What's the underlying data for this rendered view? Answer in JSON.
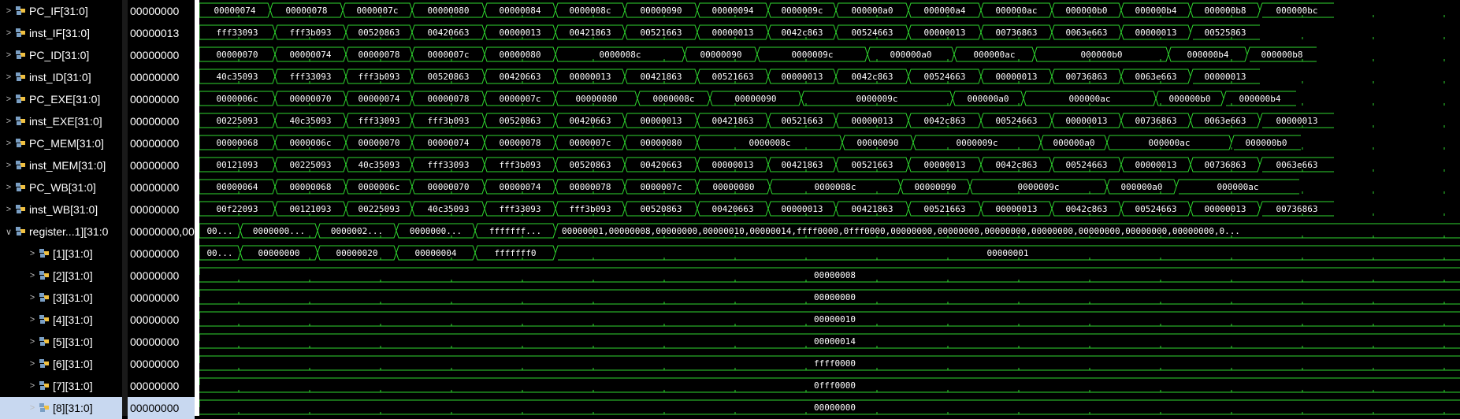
{
  "signals": [
    {
      "name": "PC_IF[31:0]",
      "value": "00000000",
      "expanded": false,
      "indent": 0,
      "segments": [
        "00000074",
        "00000078",
        "0000007c",
        "00000080",
        "00000084",
        "0000008c",
        "00000090",
        "00000094",
        "0000009c",
        "000000a0",
        "000000a4",
        "000000ac",
        "000000b0",
        "000000b4",
        "000000b8",
        "000000bc"
      ]
    },
    {
      "name": "inst_IF[31:0]",
      "value": "00000013",
      "expanded": false,
      "indent": 0,
      "segments": [
        "fff33093",
        "fff3b093",
        "00520863",
        "00420663",
        "00000013",
        "00421863",
        "00521663",
        "00000013",
        "0042c863",
        "00524663",
        "00000013",
        "00736863",
        "0063e663",
        "00000013",
        "00525863"
      ]
    },
    {
      "name": "PC_ID[31:0]",
      "value": "00000000",
      "expanded": false,
      "indent": 0,
      "segments": [
        "00000070",
        "00000074",
        "00000078",
        "0000007c",
        "00000080",
        "0000008c",
        "00000090",
        "0000009c",
        "000000a0",
        "000000ac",
        "000000b0",
        "000000b4",
        "000000b8"
      ]
    },
    {
      "name": "inst_ID[31:0]",
      "value": "00000000",
      "expanded": false,
      "indent": 0,
      "segments": [
        "40c35093",
        "fff33093",
        "fff3b093",
        "00520863",
        "00420663",
        "00000013",
        "00421863",
        "00521663",
        "00000013",
        "0042c863",
        "00524663",
        "00000013",
        "00736863",
        "0063e663",
        "00000013"
      ]
    },
    {
      "name": "PC_EXE[31:0]",
      "value": "00000000",
      "expanded": false,
      "indent": 0,
      "segments": [
        "0000006c",
        "00000070",
        "00000074",
        "00000078",
        "0000007c",
        "00000080",
        "0000008c",
        "00000090",
        "0000009c",
        "000000a0",
        "000000ac",
        "000000b0",
        "000000b4"
      ]
    },
    {
      "name": "inst_EXE[31:0]",
      "value": "00000000",
      "expanded": false,
      "indent": 0,
      "segments": [
        "00225093",
        "40c35093",
        "fff33093",
        "fff3b093",
        "00520863",
        "00420663",
        "00000013",
        "00421863",
        "00521663",
        "00000013",
        "0042c863",
        "00524663",
        "00000013",
        "00736863",
        "0063e663",
        "00000013"
      ]
    },
    {
      "name": "PC_MEM[31:0]",
      "value": "00000000",
      "expanded": false,
      "indent": 0,
      "segments": [
        "00000068",
        "0000006c",
        "00000070",
        "00000074",
        "00000078",
        "0000007c",
        "00000080",
        "0000008c",
        "00000090",
        "0000009c",
        "000000a0",
        "000000ac",
        "000000b0"
      ]
    },
    {
      "name": "inst_MEM[31:0]",
      "value": "00000000",
      "expanded": false,
      "indent": 0,
      "segments": [
        "00121093",
        "00225093",
        "40c35093",
        "fff33093",
        "fff3b093",
        "00520863",
        "00420663",
        "00000013",
        "00421863",
        "00521663",
        "00000013",
        "0042c863",
        "00524663",
        "00000013",
        "00736863",
        "0063e663"
      ]
    },
    {
      "name": "PC_WB[31:0]",
      "value": "00000000",
      "expanded": false,
      "indent": 0,
      "segments": [
        "00000064",
        "00000068",
        "0000006c",
        "00000070",
        "00000074",
        "00000078",
        "0000007c",
        "00000080",
        "0000008c",
        "00000090",
        "0000009c",
        "000000a0",
        "000000ac"
      ]
    },
    {
      "name": "inst_WB[31:0]",
      "value": "00000000",
      "expanded": false,
      "indent": 0,
      "segments": [
        "00f22093",
        "00121093",
        "00225093",
        "40c35093",
        "fff33093",
        "fff3b093",
        "00520863",
        "00420663",
        "00000013",
        "00421863",
        "00521663",
        "00000013",
        "0042c863",
        "00524663",
        "00000013",
        "00736863"
      ]
    },
    {
      "name": "register...1][31:0",
      "value": "00000000,00",
      "expanded": true,
      "indent": 0,
      "segments": [
        "00...",
        "0000000...",
        "0000002...",
        "0000000...",
        "fffffff...",
        "00000001,00000008,00000000,00000010,00000014,ffff0000,0fff0000,00000000,00000000,00000000,00000000,00000000,00000000,00000000,0..."
      ]
    },
    {
      "name": "[1][31:0]",
      "value": "00000000",
      "expanded": false,
      "indent": 1,
      "segments": [
        "00...",
        "00000000",
        "00000020",
        "00000004",
        "fffffff0",
        "00000001"
      ]
    },
    {
      "name": "[2][31:0]",
      "value": "00000000",
      "expanded": false,
      "indent": 1,
      "segments": [
        "00000008"
      ]
    },
    {
      "name": "[3][31:0]",
      "value": "00000000",
      "expanded": false,
      "indent": 1,
      "segments": [
        "00000000"
      ]
    },
    {
      "name": "[4][31:0]",
      "value": "00000000",
      "expanded": false,
      "indent": 1,
      "segments": [
        "00000010"
      ]
    },
    {
      "name": "[5][31:0]",
      "value": "00000000",
      "expanded": false,
      "indent": 1,
      "segments": [
        "00000014"
      ]
    },
    {
      "name": "[6][31:0]",
      "value": "00000000",
      "expanded": false,
      "indent": 1,
      "segments": [
        "ffff0000"
      ]
    },
    {
      "name": "[7][31:0]",
      "value": "00000000",
      "expanded": false,
      "indent": 1,
      "segments": [
        "0fff0000"
      ]
    },
    {
      "name": "[8][31:0]",
      "value": "00000000",
      "expanded": false,
      "indent": 1,
      "selected": true,
      "segments": [
        "00000000"
      ]
    }
  ],
  "colors": {
    "wave": "#2fd62f",
    "text": "#ffffff",
    "background": "#000000",
    "selection": "#c8d8f0"
  }
}
